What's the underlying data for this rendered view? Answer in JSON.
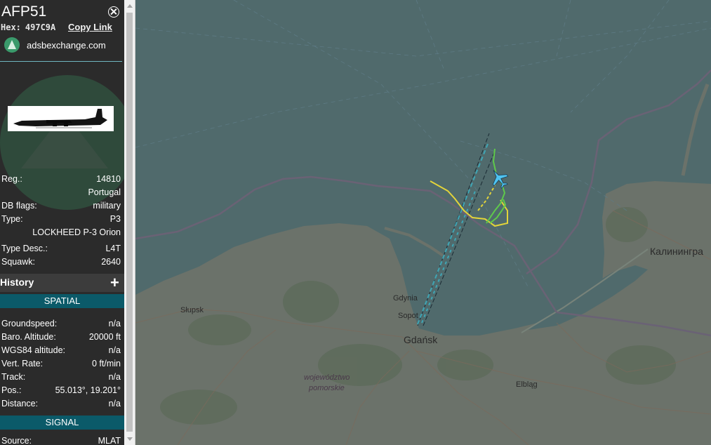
{
  "aircraft": {
    "callsign": "AFP51",
    "hex_label": "Hex:",
    "hex": "497C9A",
    "copy_link": "Copy Link",
    "source_site": "adsbexchange.com"
  },
  "details": [
    {
      "label": "Reg.:",
      "value": "14810"
    },
    {
      "label": "",
      "value": "Portugal"
    },
    {
      "label": "DB flags:",
      "value": "military"
    },
    {
      "label": "Type:",
      "value": "P3"
    },
    {
      "label": "",
      "value": "LOCKHEED P-3 Orion"
    },
    {
      "label": "Type Desc.:",
      "value": "L4T"
    },
    {
      "label": "Squawk:",
      "value": "2640"
    }
  ],
  "history": {
    "label": "History",
    "expand": "+"
  },
  "spatial": {
    "header": "SPATIAL",
    "rows": [
      {
        "label": "Groundspeed:",
        "value": "n/a"
      },
      {
        "label": "Baro. Altitude:",
        "value": "20000 ft"
      },
      {
        "label": "WGS84 altitude:",
        "value": "n/a"
      },
      {
        "label": "Vert. Rate:",
        "value": "0 ft/min"
      },
      {
        "label": "Track:",
        "value": "n/a"
      },
      {
        "label": "Pos.:",
        "value": "55.013°, 19.201°"
      },
      {
        "label": "Distance:",
        "value": "n/a"
      }
    ]
  },
  "signal": {
    "header": "SIGNAL",
    "rows": [
      {
        "label": "Source:",
        "value": "MLAT"
      }
    ]
  },
  "map": {
    "places": {
      "slupsk": "Słupsk",
      "gdynia": "Gdynia",
      "sopot": "Sopot",
      "gdansk": "Gdańsk",
      "region": "województwo",
      "region2": "pomorskie",
      "elblag": "Elbląg",
      "kaliningrad": "Калинингра"
    },
    "colors": {
      "sea": "#506a6c",
      "land": "#6b726a",
      "track_yellow": "#e3d43a",
      "track_green": "#5fc94b",
      "track_cyan": "#3fa6b5",
      "aircraft": "#4fc3f0"
    },
    "icons": [
      "close-icon",
      "adsbx-logo-icon",
      "plus-icon",
      "aircraft-icon"
    ]
  }
}
